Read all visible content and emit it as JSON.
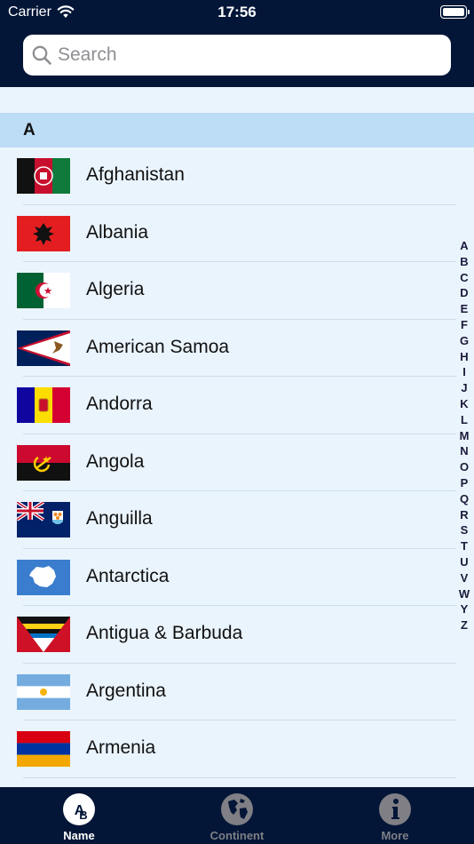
{
  "status_bar": {
    "carrier": "Carrier",
    "time": "17:56"
  },
  "search": {
    "placeholder": "Search"
  },
  "section": {
    "title": "A"
  },
  "countries": [
    {
      "name": "Afghanistan",
      "flag": "afghanistan-flag-icon"
    },
    {
      "name": "Albania",
      "flag": "albania-flag-icon"
    },
    {
      "name": "Algeria",
      "flag": "algeria-flag-icon"
    },
    {
      "name": "American Samoa",
      "flag": "american-samoa-flag-icon"
    },
    {
      "name": "Andorra",
      "flag": "andorra-flag-icon"
    },
    {
      "name": "Angola",
      "flag": "angola-flag-icon"
    },
    {
      "name": "Anguilla",
      "flag": "anguilla-flag-icon"
    },
    {
      "name": "Antarctica",
      "flag": "antarctica-flag-icon"
    },
    {
      "name": "Antigua & Barbuda",
      "flag": "antigua-barbuda-flag-icon"
    },
    {
      "name": "Argentina",
      "flag": "argentina-flag-icon"
    },
    {
      "name": "Armenia",
      "flag": "armenia-flag-icon"
    }
  ],
  "index_letters": [
    "A",
    "B",
    "C",
    "D",
    "E",
    "F",
    "G",
    "H",
    "I",
    "J",
    "K",
    "L",
    "M",
    "N",
    "O",
    "P",
    "Q",
    "R",
    "S",
    "T",
    "U",
    "V",
    "W",
    "Y",
    "Z"
  ],
  "tabs": [
    {
      "label": "Name",
      "icon": "ab-letters-icon",
      "active": true
    },
    {
      "label": "Continent",
      "icon": "globe-icon",
      "active": false
    },
    {
      "label": "More",
      "icon": "info-icon",
      "active": false
    }
  ],
  "colors": {
    "nav_background": "#031637",
    "list_background": "#eaf4fd",
    "section_header": "#bddcf6",
    "inactive_tab": "#7f7f85"
  }
}
